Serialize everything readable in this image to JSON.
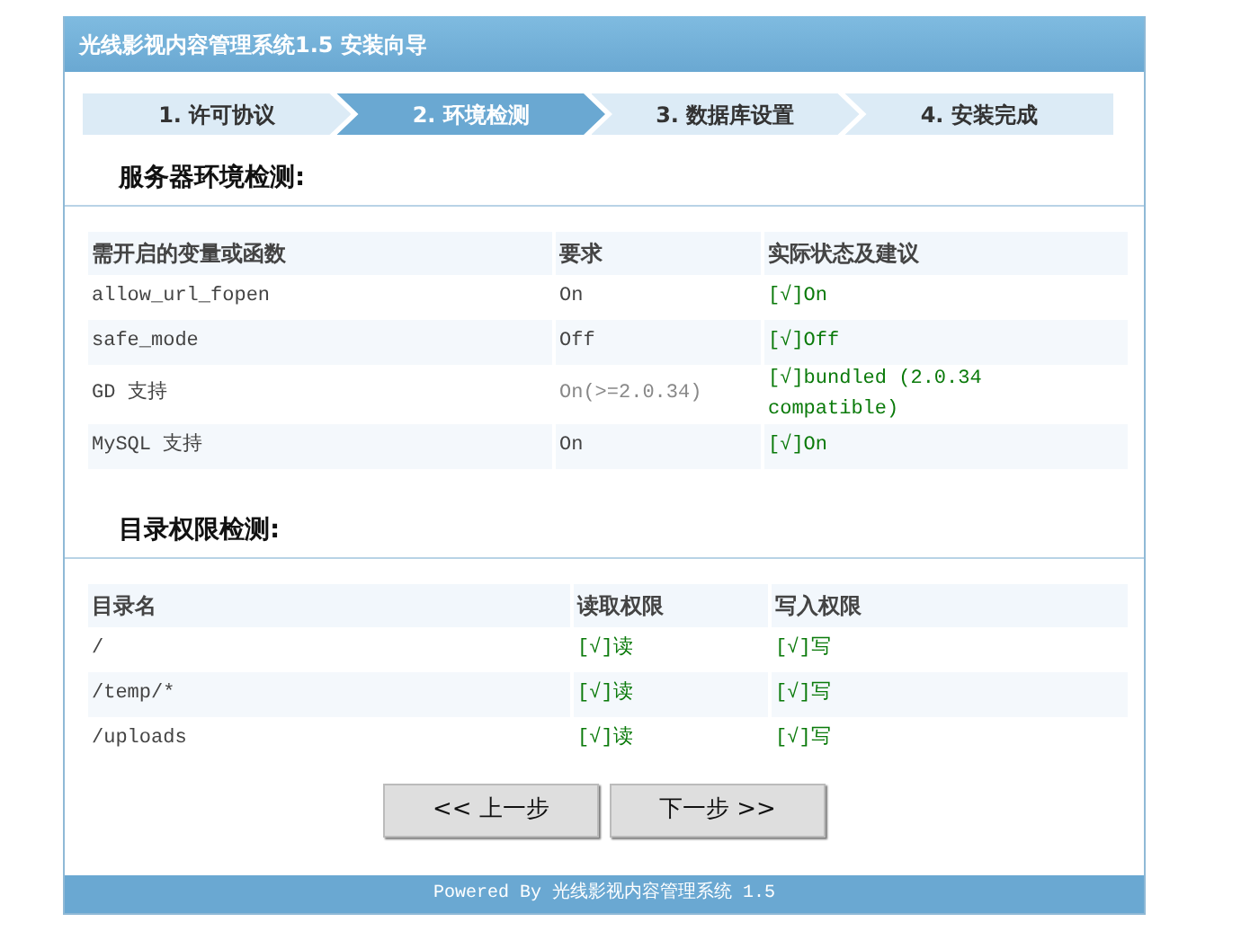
{
  "window": {
    "title": "光线影视内容管理系统1.5 安装向导"
  },
  "steps": [
    {
      "label": "1. 许可协议",
      "selected": false
    },
    {
      "label": "2. 环境检测",
      "selected": true
    },
    {
      "label": "3. 数据库设置",
      "selected": false
    },
    {
      "label": "4. 安装完成",
      "selected": false
    }
  ],
  "sections": [
    {
      "heading": "服务器环境检测:",
      "columns": [
        "需开启的变量或函数",
        "要求",
        "实际状态及建议"
      ],
      "rows": [
        {
          "cells": [
            "allow_url_fopen",
            "On",
            "[√]On"
          ],
          "ok": true
        },
        {
          "cells": [
            "safe_mode",
            "Off",
            "[√]Off"
          ],
          "ok": true
        },
        {
          "cells": [
            "GD 支持",
            "On(>=2.0.34)",
            "[√]bundled (2.0.34 compatible)"
          ],
          "ok": true
        },
        {
          "cells": [
            "MySQL 支持",
            "On",
            "[√]On"
          ],
          "ok": true
        }
      ]
    },
    {
      "heading": "目录权限检测:",
      "columns": [
        "目录名",
        "读取权限",
        "写入权限"
      ],
      "rows": [
        {
          "cells": [
            "/",
            "[√]读",
            "[√]写"
          ],
          "ok": true
        },
        {
          "cells": [
            "/temp/*",
            "[√]读",
            "[√]写"
          ],
          "ok": true
        },
        {
          "cells": [
            "/uploads",
            "[√]读",
            "[√]写"
          ],
          "ok": true
        }
      ]
    }
  ],
  "buttons": [
    "<< 上一步",
    "下一步 >>"
  ],
  "footer": "Powered By 光线影视内容管理系统 1.5"
}
